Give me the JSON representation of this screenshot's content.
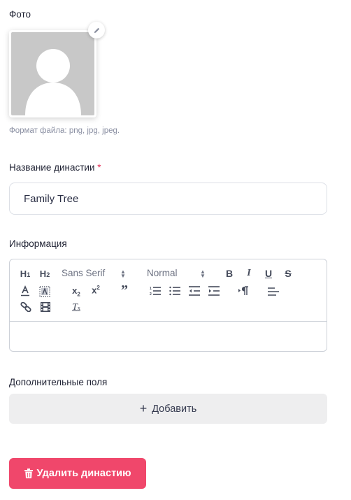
{
  "photo": {
    "label": "Фото",
    "hint": "Формат файла: png, jpg, jpeg.",
    "edit_icon": "pencil-icon"
  },
  "dynasty_name": {
    "label": "Название династии",
    "required_mark": "*",
    "value": "Family Tree"
  },
  "info": {
    "label": "Информация",
    "toolbar": {
      "font": "Sans Serif",
      "size": "Normal",
      "h1": "H1",
      "h2": "H2",
      "bold": "B",
      "italic": "I",
      "underline": "U",
      "strike": "S",
      "text_color": "A",
      "subscript": "x2",
      "superscript": "x2",
      "quote": "99",
      "clear": "Tx"
    },
    "content": ""
  },
  "extra_fields": {
    "label": "Дополнительные поля",
    "add_label": "Добавить"
  },
  "delete_label": "Удалить династию",
  "colors": {
    "danger": "#f0476b",
    "required": "#e5345b",
    "hint": "#8b90a3"
  }
}
